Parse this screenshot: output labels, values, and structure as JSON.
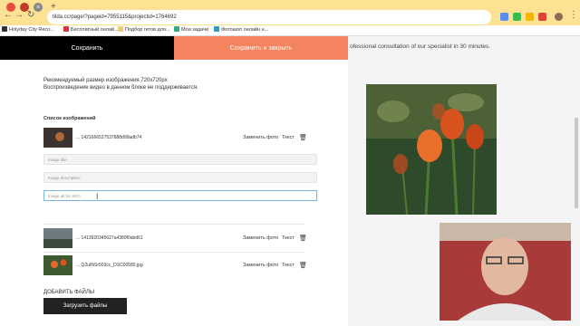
{
  "browser": {
    "url": "tilda.cc/page/?pageid=7955115&projectid=1764692"
  },
  "bookmarks": [
    {
      "label": "Holyday City Reco...",
      "color": "#333"
    },
    {
      "label": "Бесплатный онлай...",
      "color": "#d33"
    },
    {
      "label": "Подбор гетов для...",
      "color": "#ec7"
    },
    {
      "label": "Мои задачи",
      "color": "#3a8"
    },
    {
      "label": "Фотошоп онлайн н...",
      "color": "#39c"
    }
  ],
  "toolbar": {
    "save_label": "Сохранить",
    "save_close_label": "Сохранить и закрыть"
  },
  "background_text": "ofessional consultation of our specialist in 30 minutes.",
  "info": {
    "line1": "Рекомендуемый размер изображения 720x720px",
    "line2": "Воспроизведение видео в данном блоке не поддерживается."
  },
  "images_header": "Список изображений",
  "images": [
    {
      "filename": "... 1421666527537888d99adb74",
      "replace": "Заменить фото",
      "text": "Текст"
    },
    {
      "filename": "... 1413920345627a4389f0abd61",
      "replace": "Заменить фото",
      "text": "Текст"
    },
    {
      "filename": "... Q2uINSr503cc_DSC00580.jpg",
      "replace": "Заменить фото",
      "text": "Текст"
    }
  ],
  "fields": {
    "title_placeholder": "Image title",
    "description_placeholder": "Image description",
    "alt_placeholder": "Image alt for SEO"
  },
  "add_files": "ДОБАВИТЬ ФАЙЛЫ",
  "upload_button": "Загрузить файлы",
  "colors": {
    "accent": "#f4845f",
    "chrome": "#fde293"
  }
}
